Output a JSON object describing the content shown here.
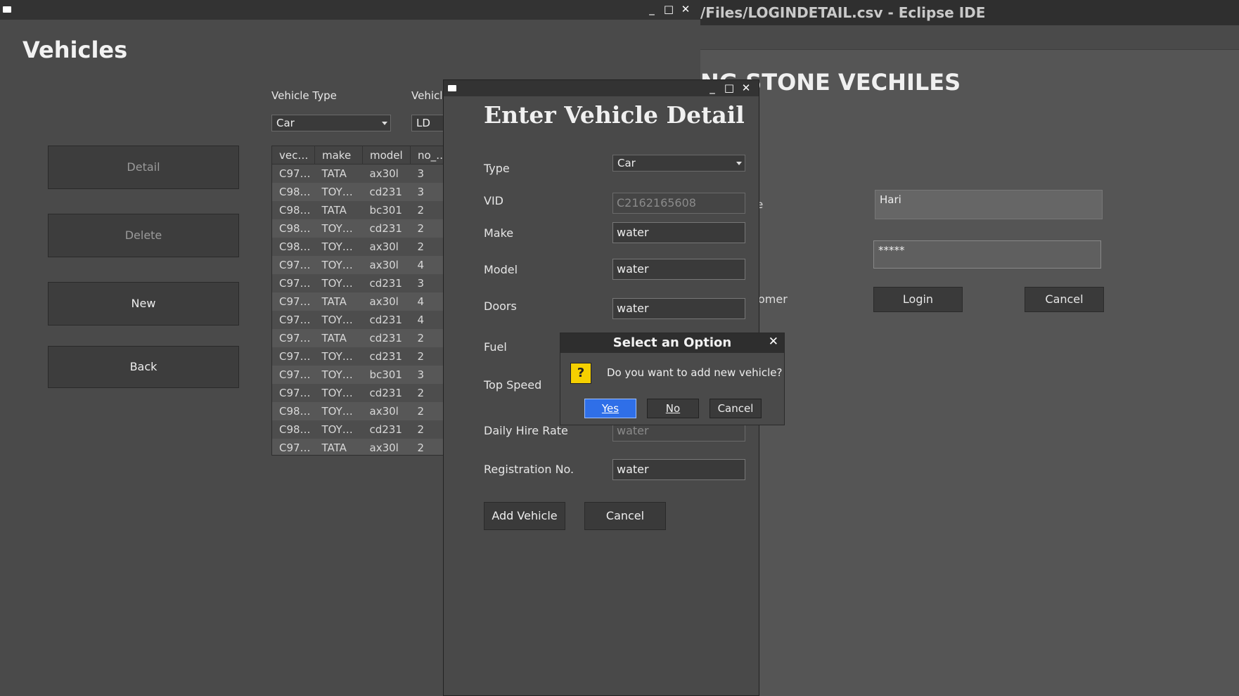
{
  "background_window": {
    "title": "/Files/LOGINDETAIL.csv - Eclipse IDE",
    "heading": "NG STONE VECHILES",
    "partial_label_1": "e",
    "partial_label_2": "omer",
    "username_value": "Hari",
    "password_value": "*****",
    "login_label": "Login",
    "cancel_label": "Cancel"
  },
  "vehicles_window": {
    "title": "Vehicles",
    "buttons": {
      "detail": "Detail",
      "delete": "Delete",
      "new": "New",
      "back": "Back"
    },
    "vehicle_type_label": "Vehicle Type",
    "vehicle_type_value": "Car",
    "vehicle_id_label": "Vehicle",
    "vehicle_id_value": "LD",
    "table": {
      "columns": [
        "vec…",
        "make",
        "model",
        "no_…"
      ],
      "rows": [
        [
          "C97…",
          "TATA",
          "ax30l",
          "3"
        ],
        [
          "C98…",
          "TOY…",
          "cd231",
          "3"
        ],
        [
          "C98…",
          "TATA",
          "bc301",
          "2"
        ],
        [
          "C98…",
          "TOY…",
          "cd231",
          "2"
        ],
        [
          "C98…",
          "TOY…",
          "ax30l",
          "2"
        ],
        [
          "C97…",
          "TOY…",
          "ax30l",
          "4"
        ],
        [
          "C97…",
          "TOY…",
          "cd231",
          "3"
        ],
        [
          "C97…",
          "TATA",
          "ax30l",
          "4"
        ],
        [
          "C97…",
          "TOY…",
          "cd231",
          "4"
        ],
        [
          "C97…",
          "TATA",
          "cd231",
          "2"
        ],
        [
          "C97…",
          "TOY…",
          "cd231",
          "2"
        ],
        [
          "C97…",
          "TOY…",
          "bc301",
          "3"
        ],
        [
          "C97…",
          "TOY…",
          "cd231",
          "2"
        ],
        [
          "C98…",
          "TOY…",
          "ax30l",
          "2"
        ],
        [
          "C98…",
          "TOY…",
          "cd231",
          "2"
        ],
        [
          "C97…",
          "TATA",
          "ax30l",
          "2"
        ]
      ]
    }
  },
  "detail_window": {
    "heading": "Enter Vehicle Detail",
    "labels": {
      "type": "Type",
      "vid": "VID",
      "make": "Make",
      "model": "Model",
      "doors": "Doors",
      "fuel": "Fuel",
      "top_speed": "Top Speed",
      "daily_hire_rate": "Daily Hire Rate",
      "registration_no": "Registration No."
    },
    "values": {
      "type": "Car",
      "vid": "C2162165608",
      "make": "water",
      "model": "water",
      "doors": "water",
      "daily_hire_rate": "water",
      "registration_no": "water"
    },
    "add_vehicle_label": "Add Vehicle",
    "cancel_label": "Cancel"
  },
  "option_dialog": {
    "title": "Select an Option",
    "message": "Do you want to add new vehicle?",
    "icon": "question-icon",
    "yes_label": "Yes",
    "no_label": "No",
    "cancel_label": "Cancel"
  },
  "colors": {
    "accent_blue": "#2f6fe8",
    "question_yellow": "#f5d000"
  }
}
